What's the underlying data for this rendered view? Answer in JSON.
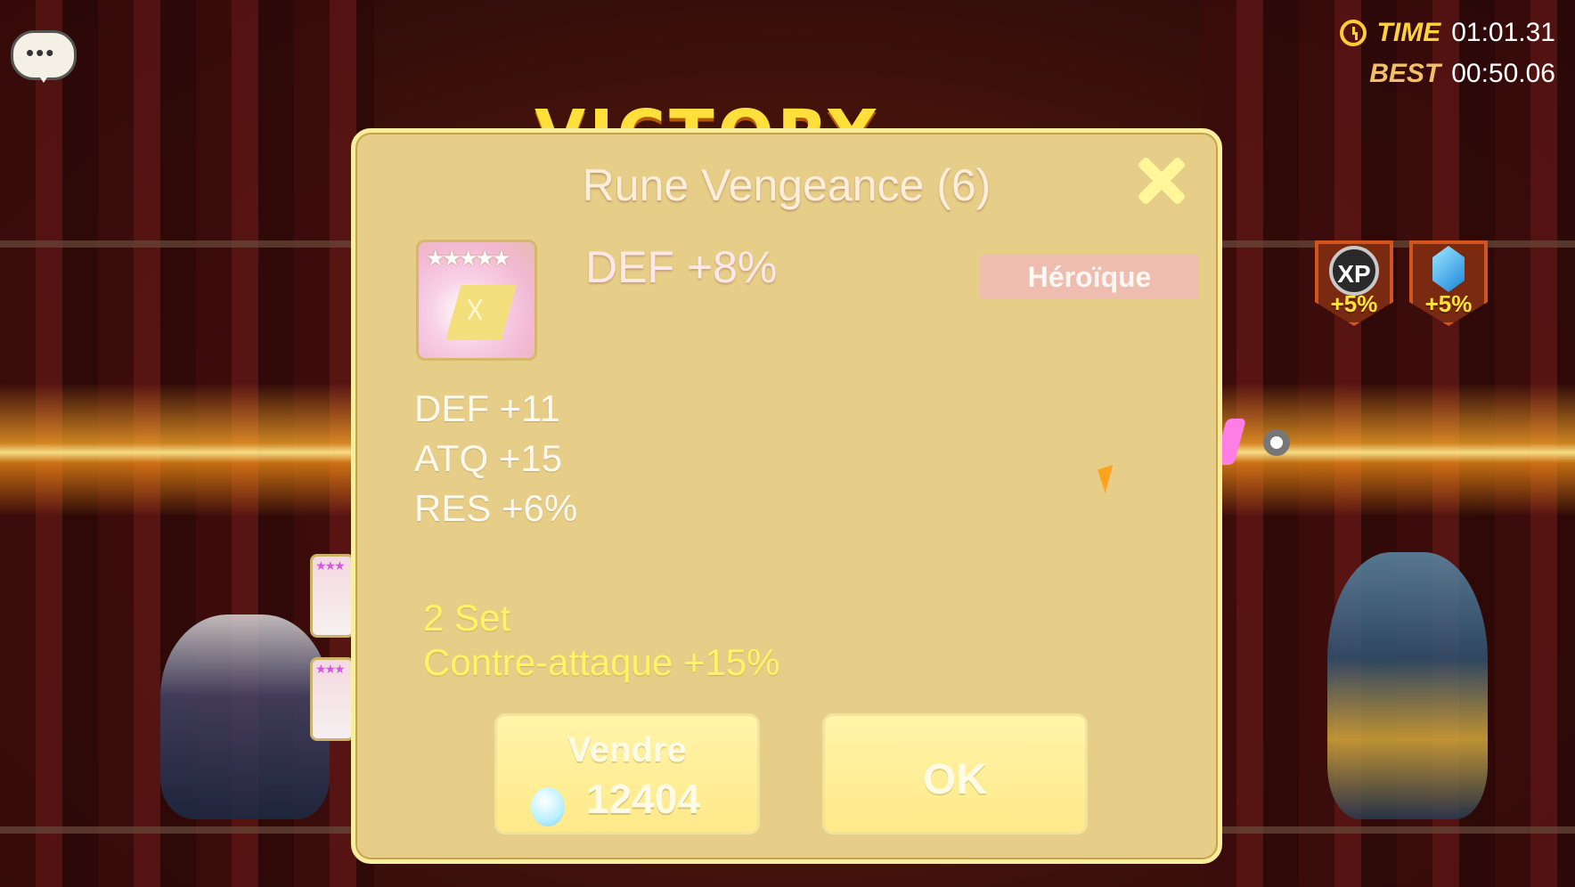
{
  "hud": {
    "time_label": "TIME",
    "time_value": "01:01.31",
    "best_label": "BEST",
    "best_value": "00:50.06",
    "chat_icon": "chat-bubble-icon",
    "clock_icon": "clock-icon"
  },
  "banner": {
    "text": "VICTORY"
  },
  "bonuses": [
    {
      "icon": "xp-icon",
      "emblem": "XP",
      "value": "+5%"
    },
    {
      "icon": "crystal-icon",
      "value": "+5%"
    }
  ],
  "modal": {
    "title": "Rune Vengeance (6)",
    "close_icon": "close-icon",
    "rune": {
      "stars": "★★★★★",
      "stars_count": 5,
      "icon": "rune-vengeance-icon"
    },
    "main_stat": "DEF +8%",
    "grade": "Héroïque",
    "sub_stats": [
      "DEF +11",
      "ATQ +15",
      "RES +6%"
    ],
    "set_bonus": {
      "line1": "2 Set",
      "line2": "Contre-attaque +15%"
    },
    "sell_button": {
      "label": "Vendre",
      "price": "12404",
      "icon": "mana-crystal-icon"
    },
    "ok_button": {
      "label": "OK"
    }
  },
  "colors": {
    "modal_bg": "#e7ce88",
    "modal_border": "#f9ee9c",
    "grade_badge": "#efbcb0",
    "set_text": "#fff566",
    "hud_label": "#ffd23a"
  }
}
